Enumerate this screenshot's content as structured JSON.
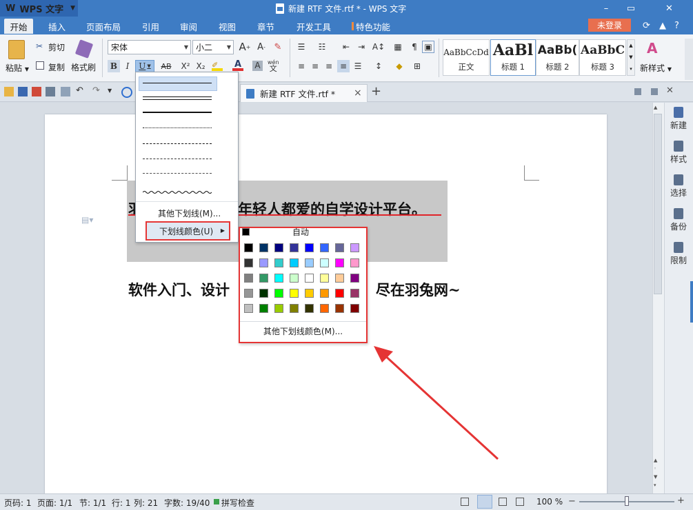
{
  "titlebar": {
    "app_name": "WPS 文字",
    "window_title": "新建 RTF 文件.rtf * - WPS 文字",
    "minimize": "–",
    "maximize": "▭",
    "close": "✕"
  },
  "menu": {
    "tabs": [
      "开始",
      "插入",
      "页面布局",
      "引用",
      "审阅",
      "视图",
      "章节",
      "开发工具",
      "特色功能"
    ],
    "login": "未登录"
  },
  "ribbon": {
    "paste": "粘贴",
    "cut": "剪切",
    "copy": "复制",
    "format_painter": "格式刷",
    "font_name": "宋体",
    "font_size": "小二",
    "bold": "B",
    "italic": "I",
    "underline": "U",
    "strike": "AB",
    "superscript": "X²",
    "subscript": "X₂",
    "phonetic": "wén",
    "styles": [
      {
        "sample": "AaBbCcDd",
        "name": "正文"
      },
      {
        "sample": "AaBl",
        "name": "标题 1"
      },
      {
        "sample": "AaBb(",
        "name": "标题 2"
      },
      {
        "sample": "AaBbC",
        "name": "标题 3"
      }
    ],
    "new_style": "新样式"
  },
  "doctab": {
    "title": "新建 RTF 文件.rtf *",
    "close": "×",
    "add": "+"
  },
  "document": {
    "line1_left": "羽",
    "line1_right": "年轻人都爱的自学设计平台。",
    "line2_left": "软件入门、设计",
    "line2_right": "尽在羽兔网~",
    "underline_color": "#e0242a"
  },
  "underline_menu": {
    "more_underlines": "其他下划线(M)...",
    "underline_color": "下划线颜色(U)"
  },
  "color_palette": {
    "auto": "自动",
    "more_colors": "其他下划线颜色(M)...",
    "rows": [
      [
        "#000000",
        "#003366",
        "#000080",
        "#333399",
        "#0000ff",
        "#3366ff",
        "#666699",
        "#cc99ff"
      ],
      [
        "#333333",
        "#9999ff",
        "#33cccc",
        "#00ccff",
        "#99ccff",
        "#ccffff",
        "#ff00ff",
        "#ff99cc"
      ],
      [
        "#808080",
        "#339966",
        "#00ffff",
        "#ccffcc",
        "#ffffff",
        "#ffff99",
        "#ffcc99",
        "#800080"
      ],
      [
        "#969696",
        "#003300",
        "#00ff00",
        "#ffff00",
        "#ffcc00",
        "#ff9900",
        "#ff0000",
        "#993366"
      ],
      [
        "#c0c0c0",
        "#008000",
        "#99cc00",
        "#808000",
        "#333300",
        "#ff6600",
        "#993300",
        "#800000"
      ]
    ]
  },
  "right_panel": [
    "新建",
    "样式",
    "选择",
    "备份",
    "限制"
  ],
  "status": {
    "page": "页码: 1",
    "pages": "页面: 1/1",
    "section": "节: 1/1",
    "row": "行: 1",
    "col": "列: 21",
    "words": "字数: 19/40",
    "spell": "拼写检查",
    "zoom": "100 %",
    "zoom_fraction": 0.5
  },
  "colors": {
    "title_blue": "#3e7cc4",
    "highlight_red": "#e53434",
    "login_orange": "#e86f4f"
  }
}
